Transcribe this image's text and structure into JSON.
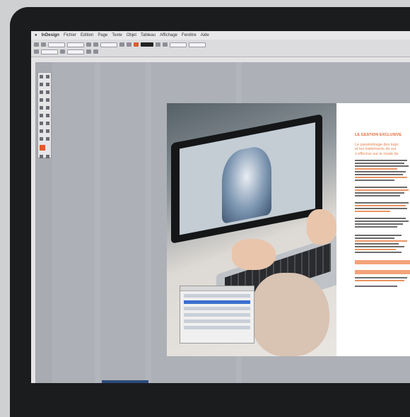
{
  "menubar": {
    "items": [
      "InDesign",
      "Fichier",
      "Edition",
      "Page",
      "Texte",
      "Objet",
      "Tableau",
      "Affichage",
      "Fenêtre",
      "Aide"
    ]
  },
  "document": {
    "right_page": {
      "title": "LE GESTION EXCLUSIVE",
      "intro_lines": [
        "Le paramétrage des logic",
        "et les traitements de sui",
        "s effectue sur le mode de"
      ]
    }
  },
  "colors": {
    "accent": "#e46a3a",
    "pasteboard": "#aeb0b7",
    "bezel": "#1b1c1e"
  }
}
